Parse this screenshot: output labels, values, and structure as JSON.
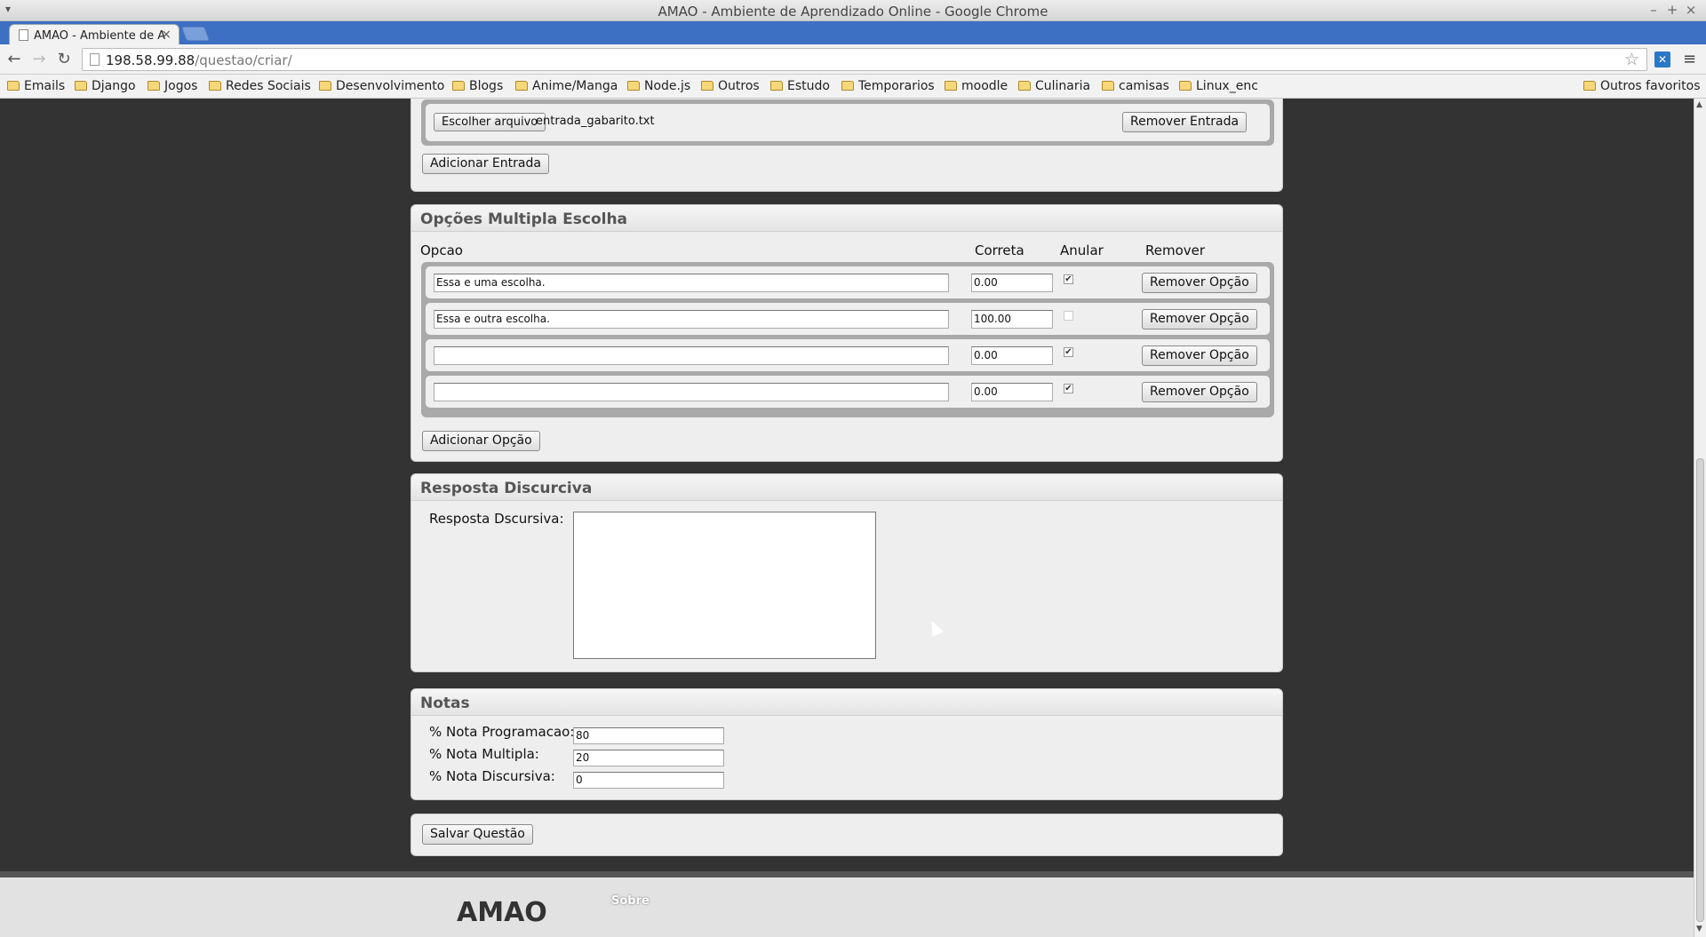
{
  "window": {
    "title": "AMAO - Ambiente de Aprendizado Online - Google Chrome",
    "controls": [
      "–",
      "+",
      "×"
    ]
  },
  "tab": {
    "title": "AMAO - Ambiente de Ap",
    "close": "×"
  },
  "address": {
    "host": "198.58.99.88",
    "path": "/questao/criar/"
  },
  "bookmarks": [
    "Emails",
    "Django",
    "Jogos",
    "Redes Sociais",
    "Desenvolvimento",
    "Blogs",
    "Anime/Manga",
    "Node.js",
    "Outros",
    "Estudo",
    "Temporarios",
    "moodle",
    "Culinaria",
    "camisas",
    "Linux_enc"
  ],
  "bookmarks_other": "Outros favoritos",
  "entradas": {
    "file_button": "Escolher arquivo",
    "file_name": "entrada_gabarito.txt",
    "remove_button": "Remover Entrada",
    "add_button": "Adicionar Entrada"
  },
  "multipla": {
    "header": "Opções Multipla Escolha",
    "col_opcao": "Opcao",
    "col_correta": "Correta",
    "col_anular": "Anular",
    "col_remover": "Remover",
    "options": [
      {
        "text": "Essa e uma escolha.",
        "correta": "0.00",
        "anular": true,
        "remove": "Remover Opção"
      },
      {
        "text": "Essa e outra escolha.",
        "correta": "100.00",
        "anular": false,
        "remove": "Remover Opção"
      },
      {
        "text": "",
        "correta": "0.00",
        "anular": true,
        "remove": "Remover Opção"
      },
      {
        "text": "",
        "correta": "0.00",
        "anular": true,
        "remove": "Remover Opção"
      }
    ],
    "add_button": "Adicionar Opção"
  },
  "discursiva": {
    "header": "Resposta Discurciva",
    "label": "Resposta Dscursiva:",
    "value": ""
  },
  "notas": {
    "header": "Notas",
    "programacao_label": "% Nota Programacao:",
    "programacao_value": "80",
    "multipla_label": "% Nota Multipla:",
    "multipla_value": "20",
    "discursiva_label": "% Nota Discursiva:",
    "discursiva_value": "0"
  },
  "save_button": "Salvar Questão",
  "footer": {
    "brand": "AMAO",
    "sobre": "Sobre"
  },
  "icons": {
    "check": "✔",
    "back": "←",
    "forward": "→",
    "reload": "↻",
    "star": "☆",
    "menu": "≡",
    "ext": "✕",
    "scroll_up": "▲",
    "scroll_down": "▼"
  }
}
